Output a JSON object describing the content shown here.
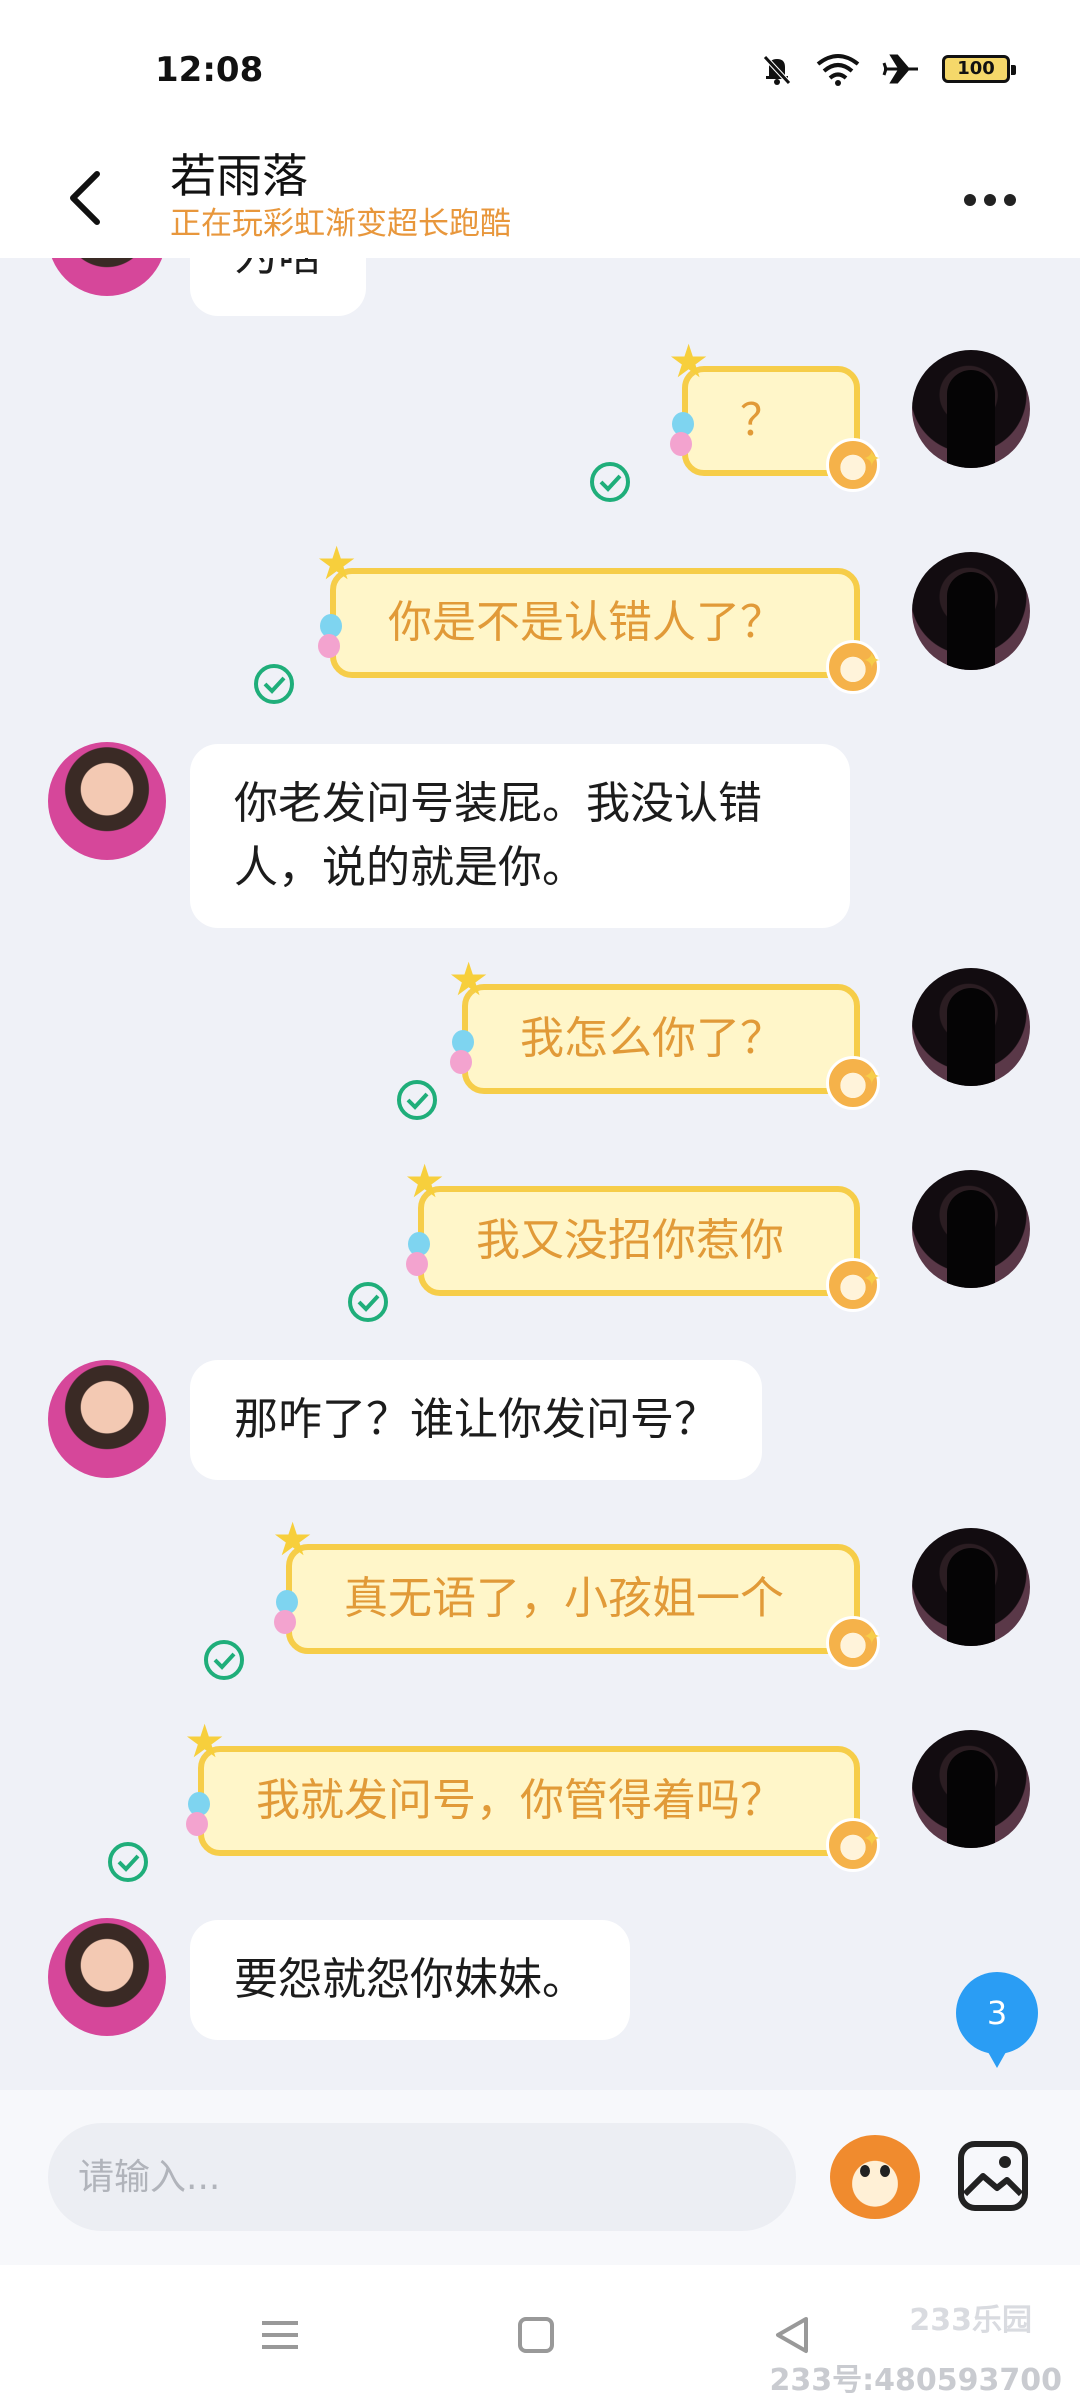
{
  "status_bar": {
    "time": "12:08",
    "battery": "100"
  },
  "header": {
    "name": "若雨落",
    "status": "正在玩彩虹渐变超长跑酷"
  },
  "messages": [
    {
      "side": "in",
      "text": "为啥"
    },
    {
      "side": "out",
      "text": "？"
    },
    {
      "side": "out",
      "text": "你是不是认错人了？"
    },
    {
      "side": "in",
      "text": "你老发问号装屁。我没认错人，说的就是你。"
    },
    {
      "side": "out",
      "text": "我怎么你了？"
    },
    {
      "side": "out",
      "text": "我又没招你惹你"
    },
    {
      "side": "in",
      "text": "那咋了？谁让你发问号？"
    },
    {
      "side": "out",
      "text": "真无语了，小孩姐一个"
    },
    {
      "side": "out",
      "text": "我就发问号，你管得着吗？"
    },
    {
      "side": "in",
      "text": "要怨就怨你妹妹。"
    }
  ],
  "unread_count": "3",
  "input": {
    "placeholder": "请输入..."
  },
  "watermark": {
    "logo": "233乐园",
    "id": "233号:480593700"
  },
  "colors": {
    "accent_orange": "#e19a38",
    "read_check": "#1fae7a",
    "badge_blue": "#2a9df4"
  }
}
